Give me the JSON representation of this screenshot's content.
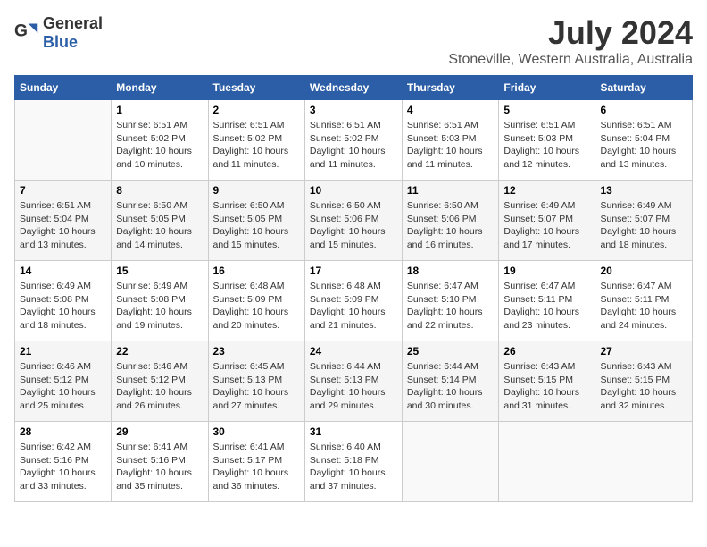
{
  "logo": {
    "text_general": "General",
    "text_blue": "Blue"
  },
  "header": {
    "title": "July 2024",
    "subtitle": "Stoneville, Western Australia, Australia"
  },
  "calendar": {
    "days_of_week": [
      "Sunday",
      "Monday",
      "Tuesday",
      "Wednesday",
      "Thursday",
      "Friday",
      "Saturday"
    ],
    "weeks": [
      [
        {
          "number": "",
          "sunrise": "",
          "sunset": "",
          "daylight": "",
          "empty": true
        },
        {
          "number": "1",
          "sunrise": "Sunrise: 6:51 AM",
          "sunset": "Sunset: 5:02 PM",
          "daylight": "Daylight: 10 hours and 10 minutes."
        },
        {
          "number": "2",
          "sunrise": "Sunrise: 6:51 AM",
          "sunset": "Sunset: 5:02 PM",
          "daylight": "Daylight: 10 hours and 11 minutes."
        },
        {
          "number": "3",
          "sunrise": "Sunrise: 6:51 AM",
          "sunset": "Sunset: 5:02 PM",
          "daylight": "Daylight: 10 hours and 11 minutes."
        },
        {
          "number": "4",
          "sunrise": "Sunrise: 6:51 AM",
          "sunset": "Sunset: 5:03 PM",
          "daylight": "Daylight: 10 hours and 11 minutes."
        },
        {
          "number": "5",
          "sunrise": "Sunrise: 6:51 AM",
          "sunset": "Sunset: 5:03 PM",
          "daylight": "Daylight: 10 hours and 12 minutes."
        },
        {
          "number": "6",
          "sunrise": "Sunrise: 6:51 AM",
          "sunset": "Sunset: 5:04 PM",
          "daylight": "Daylight: 10 hours and 13 minutes."
        }
      ],
      [
        {
          "number": "7",
          "sunrise": "Sunrise: 6:51 AM",
          "sunset": "Sunset: 5:04 PM",
          "daylight": "Daylight: 10 hours and 13 minutes."
        },
        {
          "number": "8",
          "sunrise": "Sunrise: 6:50 AM",
          "sunset": "Sunset: 5:05 PM",
          "daylight": "Daylight: 10 hours and 14 minutes."
        },
        {
          "number": "9",
          "sunrise": "Sunrise: 6:50 AM",
          "sunset": "Sunset: 5:05 PM",
          "daylight": "Daylight: 10 hours and 15 minutes."
        },
        {
          "number": "10",
          "sunrise": "Sunrise: 6:50 AM",
          "sunset": "Sunset: 5:06 PM",
          "daylight": "Daylight: 10 hours and 15 minutes."
        },
        {
          "number": "11",
          "sunrise": "Sunrise: 6:50 AM",
          "sunset": "Sunset: 5:06 PM",
          "daylight": "Daylight: 10 hours and 16 minutes."
        },
        {
          "number": "12",
          "sunrise": "Sunrise: 6:49 AM",
          "sunset": "Sunset: 5:07 PM",
          "daylight": "Daylight: 10 hours and 17 minutes."
        },
        {
          "number": "13",
          "sunrise": "Sunrise: 6:49 AM",
          "sunset": "Sunset: 5:07 PM",
          "daylight": "Daylight: 10 hours and 18 minutes."
        }
      ],
      [
        {
          "number": "14",
          "sunrise": "Sunrise: 6:49 AM",
          "sunset": "Sunset: 5:08 PM",
          "daylight": "Daylight: 10 hours and 18 minutes."
        },
        {
          "number": "15",
          "sunrise": "Sunrise: 6:49 AM",
          "sunset": "Sunset: 5:08 PM",
          "daylight": "Daylight: 10 hours and 19 minutes."
        },
        {
          "number": "16",
          "sunrise": "Sunrise: 6:48 AM",
          "sunset": "Sunset: 5:09 PM",
          "daylight": "Daylight: 10 hours and 20 minutes."
        },
        {
          "number": "17",
          "sunrise": "Sunrise: 6:48 AM",
          "sunset": "Sunset: 5:09 PM",
          "daylight": "Daylight: 10 hours and 21 minutes."
        },
        {
          "number": "18",
          "sunrise": "Sunrise: 6:47 AM",
          "sunset": "Sunset: 5:10 PM",
          "daylight": "Daylight: 10 hours and 22 minutes."
        },
        {
          "number": "19",
          "sunrise": "Sunrise: 6:47 AM",
          "sunset": "Sunset: 5:11 PM",
          "daylight": "Daylight: 10 hours and 23 minutes."
        },
        {
          "number": "20",
          "sunrise": "Sunrise: 6:47 AM",
          "sunset": "Sunset: 5:11 PM",
          "daylight": "Daylight: 10 hours and 24 minutes."
        }
      ],
      [
        {
          "number": "21",
          "sunrise": "Sunrise: 6:46 AM",
          "sunset": "Sunset: 5:12 PM",
          "daylight": "Daylight: 10 hours and 25 minutes."
        },
        {
          "number": "22",
          "sunrise": "Sunrise: 6:46 AM",
          "sunset": "Sunset: 5:12 PM",
          "daylight": "Daylight: 10 hours and 26 minutes."
        },
        {
          "number": "23",
          "sunrise": "Sunrise: 6:45 AM",
          "sunset": "Sunset: 5:13 PM",
          "daylight": "Daylight: 10 hours and 27 minutes."
        },
        {
          "number": "24",
          "sunrise": "Sunrise: 6:44 AM",
          "sunset": "Sunset: 5:13 PM",
          "daylight": "Daylight: 10 hours and 29 minutes."
        },
        {
          "number": "25",
          "sunrise": "Sunrise: 6:44 AM",
          "sunset": "Sunset: 5:14 PM",
          "daylight": "Daylight: 10 hours and 30 minutes."
        },
        {
          "number": "26",
          "sunrise": "Sunrise: 6:43 AM",
          "sunset": "Sunset: 5:15 PM",
          "daylight": "Daylight: 10 hours and 31 minutes."
        },
        {
          "number": "27",
          "sunrise": "Sunrise: 6:43 AM",
          "sunset": "Sunset: 5:15 PM",
          "daylight": "Daylight: 10 hours and 32 minutes."
        }
      ],
      [
        {
          "number": "28",
          "sunrise": "Sunrise: 6:42 AM",
          "sunset": "Sunset: 5:16 PM",
          "daylight": "Daylight: 10 hours and 33 minutes."
        },
        {
          "number": "29",
          "sunrise": "Sunrise: 6:41 AM",
          "sunset": "Sunset: 5:16 PM",
          "daylight": "Daylight: 10 hours and 35 minutes."
        },
        {
          "number": "30",
          "sunrise": "Sunrise: 6:41 AM",
          "sunset": "Sunset: 5:17 PM",
          "daylight": "Daylight: 10 hours and 36 minutes."
        },
        {
          "number": "31",
          "sunrise": "Sunrise: 6:40 AM",
          "sunset": "Sunset: 5:18 PM",
          "daylight": "Daylight: 10 hours and 37 minutes."
        },
        {
          "number": "",
          "sunrise": "",
          "sunset": "",
          "daylight": "",
          "empty": true
        },
        {
          "number": "",
          "sunrise": "",
          "sunset": "",
          "daylight": "",
          "empty": true
        },
        {
          "number": "",
          "sunrise": "",
          "sunset": "",
          "daylight": "",
          "empty": true
        }
      ]
    ]
  }
}
